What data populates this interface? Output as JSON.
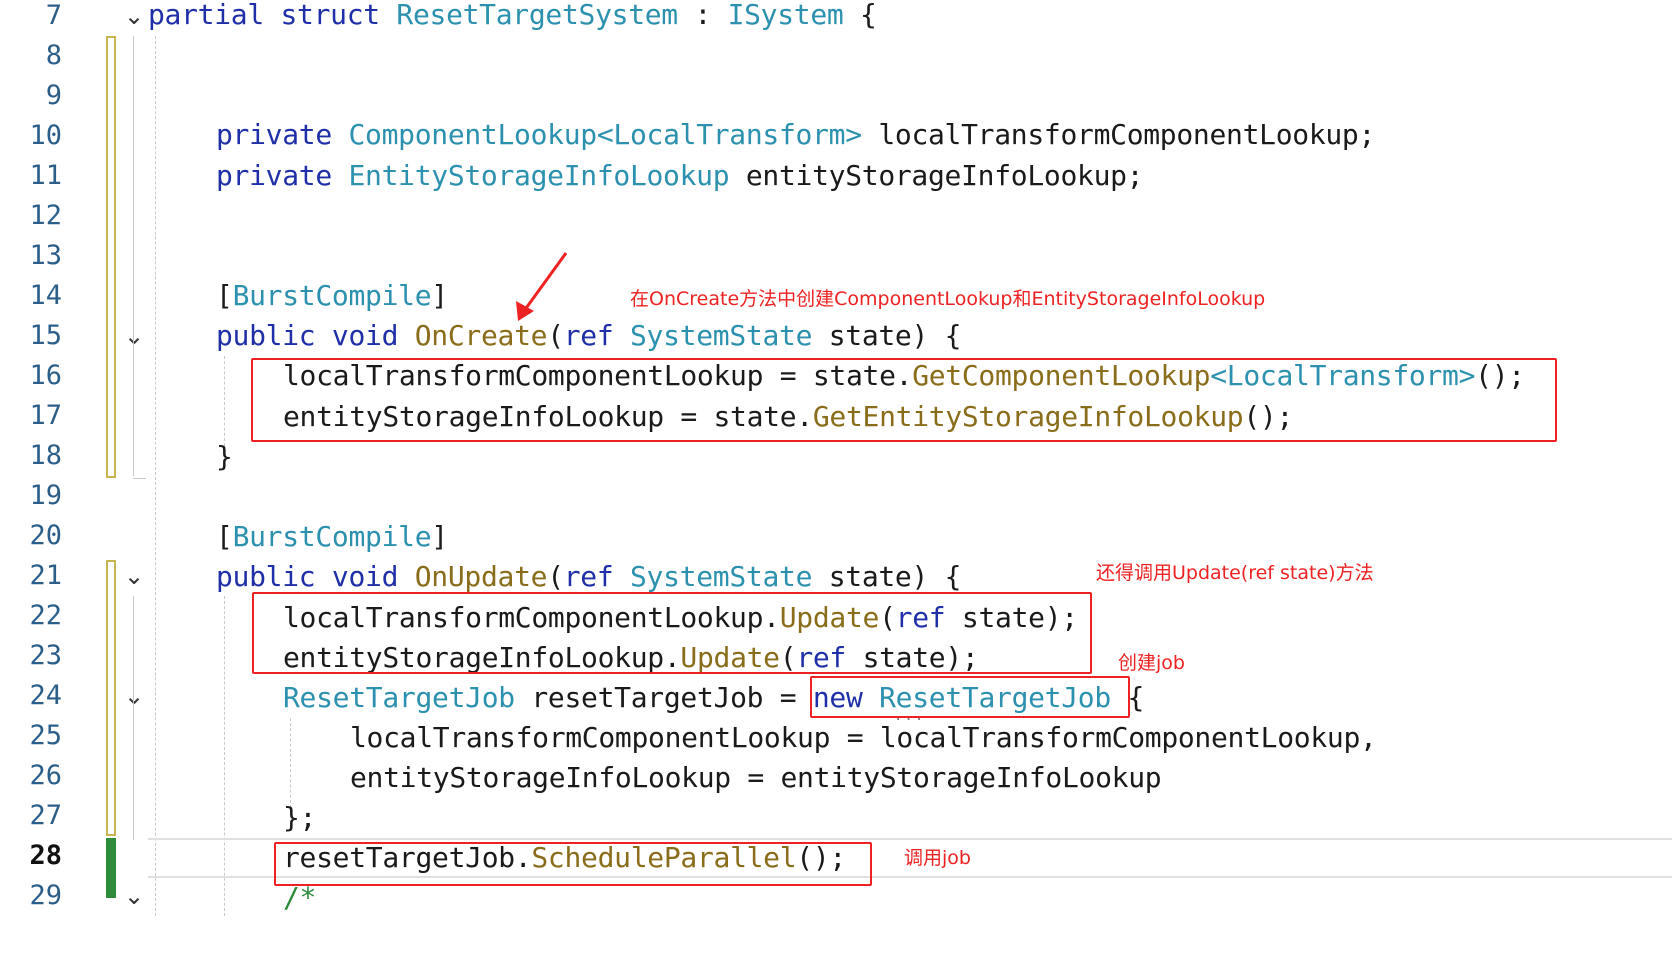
{
  "line_numbers": [
    "7",
    "8",
    "9",
    "10",
    "11",
    "12",
    "13",
    "14",
    "15",
    "16",
    "17",
    "18",
    "19",
    "20",
    "21",
    "22",
    "23",
    "24",
    "25",
    "26",
    "27",
    "28",
    "29"
  ],
  "code": {
    "l7_partial": "partial",
    "l7_struct": "struct",
    "l7_name": "ResetTargetSystem",
    "l7_colon": ":",
    "l7_iface": "ISystem",
    "l7_brace": "{",
    "l10_private": "private",
    "l10_type": "ComponentLookup",
    "l10_generic": "<LocalTransform>",
    "l10_field": "localTransformComponentLookup;",
    "l11_private": "private",
    "l11_type": "EntityStorageInfoLookup",
    "l11_field": "entityStorageInfoLookup;",
    "l14_open": "[",
    "l14_attr": "BurstCompile",
    "l14_close": "]",
    "l15_public": "public",
    "l15_void": "void",
    "l15_method": "OnCreate",
    "l15_paren": "(",
    "l15_ref": "ref",
    "l15_type": "SystemState",
    "l15_param": "state) {",
    "l16_lhs": "localTransformComponentLookup = state.",
    "l16_call": "GetComponentLookup",
    "l16_generic": "<LocalTransform>",
    "l16_end": "();",
    "l17_lhs": "entityStorageInfoLookup = state.",
    "l17_call": "GetEntityStorageInfoLookup",
    "l17_end": "();",
    "l18_brace": "}",
    "l20_open": "[",
    "l20_attr": "BurstCompile",
    "l20_close": "]",
    "l21_public": "public",
    "l21_void": "void",
    "l21_method": "OnUpdate",
    "l21_paren": "(",
    "l21_ref": "ref",
    "l21_type": "SystemState",
    "l21_param": "state) {",
    "l22_obj": "localTransformComponentLookup.",
    "l22_call": "Update",
    "l22_paren": "(",
    "l22_ref": "ref",
    "l22_end": "state);",
    "l23_obj": "entityStorageInfoLookup.",
    "l23_call": "Update",
    "l23_paren": "(",
    "l23_ref": "ref",
    "l23_end": "state);",
    "l24_type": "ResetTargetJob",
    "l24_var": "resetTargetJob =",
    "l24_new": "new",
    "l24_ctor": "ResetTargetJob",
    "l24_brace": "{",
    "l25_text": "localTransformComponentLookup = localTransformComponentLookup,",
    "l26_text": "entityStorageInfoLookup = entityStorageInfoLookup",
    "l27_text": "};",
    "l28_obj": "resetTargetJob.",
    "l28_call": "ScheduleParallel",
    "l28_end": "();",
    "l29_comment": "/*"
  },
  "annotations": {
    "note_oncreate": "在OnCreate方法中创建ComponentLookup和EntityStorageInfoLookup",
    "note_update": "还得调用Update(ref state)方法",
    "note_create_job": "创建job",
    "note_call_job": "调用job"
  },
  "colors": {
    "keyword": "#1f2fa8",
    "type": "#2b91af",
    "method": "#8a6d1a",
    "annotation": "#ee2222",
    "saved_change": "#2d8b3a",
    "unsaved_change": "#c8b450"
  }
}
